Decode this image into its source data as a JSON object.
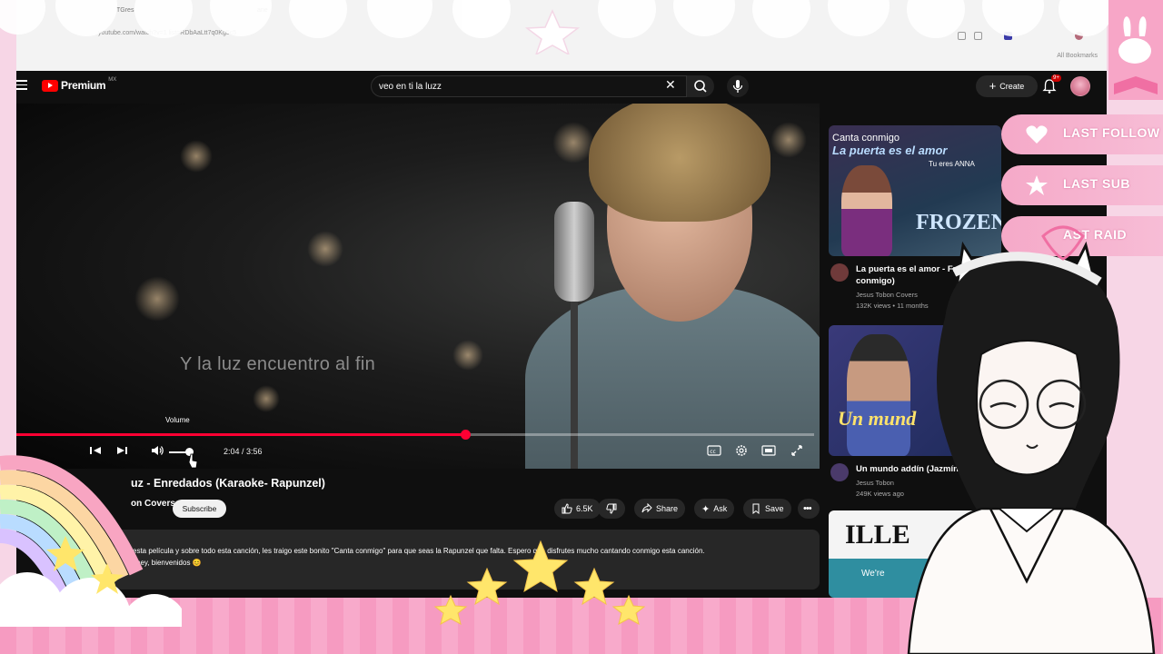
{
  "browser": {
    "tab_labels": [
      "TGres",
      "ane"
    ],
    "address": "youtube.com/watch?v=1            list=RDbAaLtt7q0Kg5c5",
    "bookmarks_label": "All Bookmarks"
  },
  "youtube": {
    "logo_text": "Premium",
    "logo_region": "MX",
    "search_query": "veo en ti la luzz",
    "create_label": "Create",
    "notification_badge": "9+"
  },
  "player": {
    "lyric_caption": "Y la luz encuentro al fin",
    "volume_tooltip": "Volume",
    "time_display": "2:04 / 3:56",
    "progress_fraction": 0.5626,
    "volume_fraction": 0.7
  },
  "video": {
    "title": "uz - Enredados (Karaoke- Rapunzel)",
    "channel": "on Covers",
    "subscribe_label": "Subscribe",
    "like_count": "6.5K",
    "share_label": "Share",
    "ask_label": "Ask",
    "save_label": "Save",
    "description_line1": "esta película y sobre todo esta canción, les traigo este bonito \"Canta conmigo\" para que seas la Rapunzel que        falta. Espero que disfrutes mucho cantando conmigo esta canción.",
    "description_line2": "sney, bienvenidos 😊"
  },
  "sidebar": {
    "items": [
      {
        "thumb_small": "Canta conmigo",
        "thumb_title": "La puerta es el amor",
        "thumb_sub": "Tu eres ANNA",
        "thumb_big": "FROZEN",
        "title": "La puerta es el amor - Fro Canta conmigo)",
        "channel": "Jesus Tobon Covers",
        "meta": "132K views • 11 months"
      },
      {
        "thumb_big": "Un mund",
        "title": "Un mundo                 addín (Jazmín",
        "channel": "Jesus Tobon",
        "meta": "249K views                 ago"
      },
      {
        "thumb_big": "ILLE",
        "thumb_sub": "We're"
      }
    ]
  },
  "stream_overlay": {
    "last_follow": "LAST FOLLOW",
    "last_sub": "LAST SUB",
    "last_raid": "AST RAID"
  },
  "colors": {
    "progress": "#ff0033",
    "overlay_pink": "#f5a9c8",
    "youtube_bg": "#0f0f0f"
  }
}
